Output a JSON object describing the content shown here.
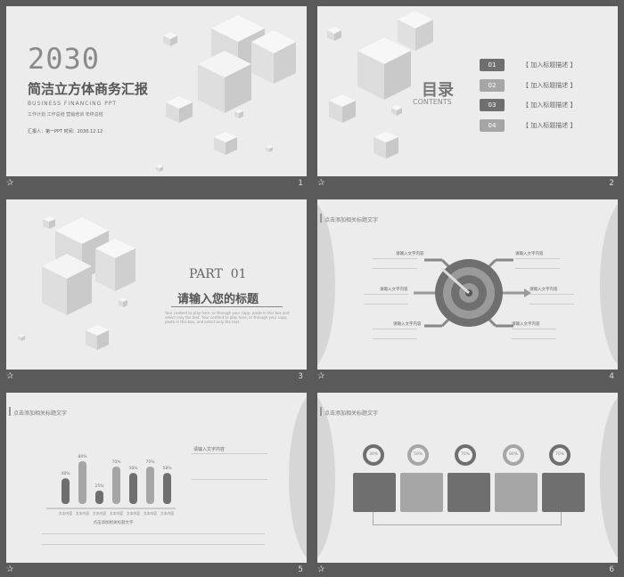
{
  "slides": [
    {
      "number": "1",
      "year": "2030",
      "title": "简洁立方体商务汇报",
      "subtitle": "BUSINESS FINANCING PPT",
      "tags": "工作计划  工作总结  营销培训  年终总结",
      "reporter": "汇报人：第一PPT   时间：2030.12.12"
    },
    {
      "number": "2",
      "title": "目录",
      "subtitle": "CONTENTS",
      "items": [
        {
          "num": "01",
          "label": "【 加入标题描述 】"
        },
        {
          "num": "02",
          "label": "【 加入标题描述 】"
        },
        {
          "num": "03",
          "label": "【 加入标题描述 】"
        },
        {
          "num": "04",
          "label": "【 加入标题描述 】"
        }
      ]
    },
    {
      "number": "3",
      "part": "PART  01",
      "title": "请输入您的标题",
      "body": "Your content to play here, or through your copy, paste in this box and select only the text. Your content to play here, or through your copy, paste in this box, and select only the text."
    },
    {
      "number": "4",
      "header": "点击添加相关标题文字",
      "labels": [
        "请输入文字内容",
        "请输入文字内容",
        "请输入文字内容",
        "请输入文字内容",
        "请输入文字内容",
        "请输入文字内容"
      ]
    },
    {
      "number": "5",
      "header": "点击添加相关标题文字",
      "side_title": "请输入文字内容",
      "caption": "点击添加相关标题文字"
    },
    {
      "number": "6",
      "header": "点击添加相关标题文字",
      "pins": [
        "30%",
        "50%",
        "70%",
        "80%",
        "70%"
      ]
    }
  ],
  "chart_data": {
    "type": "bar",
    "categories": [
      "文本内容",
      "文本内容",
      "文本内容",
      "文本内容",
      "文本内容",
      "文本内容",
      "文本内容"
    ],
    "values": [
      48,
      80,
      25,
      70,
      58,
      70,
      58
    ],
    "labels": [
      "48%",
      "80%",
      "25%",
      "70%",
      "58%",
      "70%",
      "58%"
    ]
  },
  "colors": {
    "background": "#5a5a5a",
    "slide": "#ececec",
    "accent": "#6f6f6f",
    "dark": "#555555"
  }
}
